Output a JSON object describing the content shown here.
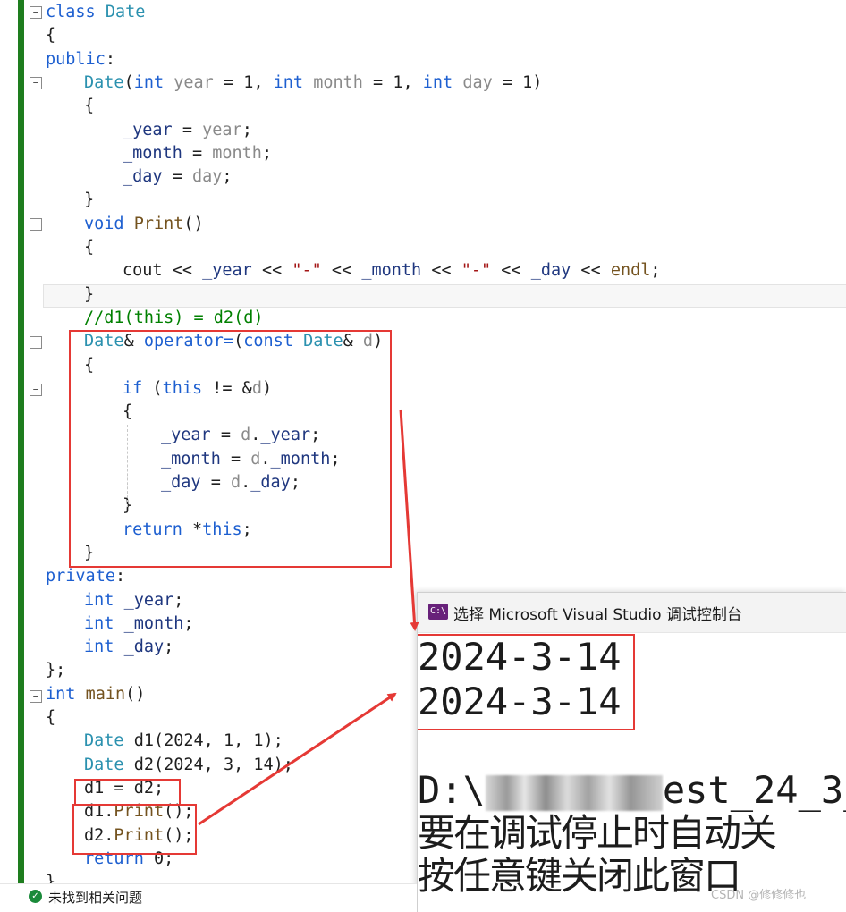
{
  "code": {
    "lines": [
      {
        "indent": 0,
        "tokens": [
          {
            "t": "class ",
            "c": "kw"
          },
          {
            "t": "Date",
            "c": "ty"
          }
        ]
      },
      {
        "indent": 0,
        "tokens": [
          {
            "t": "{",
            "c": ""
          }
        ]
      },
      {
        "indent": 0,
        "tokens": [
          {
            "t": "public",
            "c": "kw"
          },
          {
            "t": ":",
            "c": ""
          }
        ]
      },
      {
        "indent": 1,
        "tokens": [
          {
            "t": "Date",
            "c": "ty"
          },
          {
            "t": "(",
            "c": ""
          },
          {
            "t": "int",
            "c": "kw"
          },
          {
            "t": " ",
            "c": ""
          },
          {
            "t": "year",
            "c": "pa"
          },
          {
            "t": " = 1, ",
            "c": ""
          },
          {
            "t": "int",
            "c": "kw"
          },
          {
            "t": " ",
            "c": ""
          },
          {
            "t": "month",
            "c": "pa"
          },
          {
            "t": " = 1, ",
            "c": ""
          },
          {
            "t": "int",
            "c": "kw"
          },
          {
            "t": " ",
            "c": ""
          },
          {
            "t": "day",
            "c": "pa"
          },
          {
            "t": " = 1)",
            "c": ""
          }
        ]
      },
      {
        "indent": 1,
        "tokens": [
          {
            "t": "{",
            "c": ""
          }
        ]
      },
      {
        "indent": 2,
        "tokens": [
          {
            "t": "_year",
            "c": "mb"
          },
          {
            "t": " = ",
            "c": ""
          },
          {
            "t": "year",
            "c": "pa"
          },
          {
            "t": ";",
            "c": ""
          }
        ]
      },
      {
        "indent": 2,
        "tokens": [
          {
            "t": "_month",
            "c": "mb"
          },
          {
            "t": " = ",
            "c": ""
          },
          {
            "t": "month",
            "c": "pa"
          },
          {
            "t": ";",
            "c": ""
          }
        ]
      },
      {
        "indent": 2,
        "tokens": [
          {
            "t": "_day",
            "c": "mb"
          },
          {
            "t": " = ",
            "c": ""
          },
          {
            "t": "day",
            "c": "pa"
          },
          {
            "t": ";",
            "c": ""
          }
        ]
      },
      {
        "indent": 1,
        "tokens": [
          {
            "t": "}",
            "c": ""
          }
        ]
      },
      {
        "indent": 1,
        "tokens": [
          {
            "t": "void",
            "c": "kw"
          },
          {
            "t": " ",
            "c": ""
          },
          {
            "t": "Print",
            "c": "fn"
          },
          {
            "t": "()",
            "c": ""
          }
        ]
      },
      {
        "indent": 1,
        "tokens": [
          {
            "t": "{",
            "c": ""
          }
        ]
      },
      {
        "indent": 2,
        "tokens": [
          {
            "t": "cout << ",
            "c": ""
          },
          {
            "t": "_year",
            "c": "mb"
          },
          {
            "t": " << ",
            "c": ""
          },
          {
            "t": "\"-\"",
            "c": "st"
          },
          {
            "t": " << ",
            "c": ""
          },
          {
            "t": "_month",
            "c": "mb"
          },
          {
            "t": " << ",
            "c": ""
          },
          {
            "t": "\"-\"",
            "c": "st"
          },
          {
            "t": " << ",
            "c": ""
          },
          {
            "t": "_day",
            "c": "mb"
          },
          {
            "t": " << ",
            "c": ""
          },
          {
            "t": "endl",
            "c": "fn"
          },
          {
            "t": ";",
            "c": ""
          }
        ]
      },
      {
        "indent": 1,
        "tokens": [
          {
            "t": "}",
            "c": ""
          }
        ]
      },
      {
        "indent": 1,
        "tokens": [
          {
            "t": "//d1(this) = d2(d)",
            "c": "cm"
          }
        ]
      },
      {
        "indent": 1,
        "tokens": [
          {
            "t": "Date",
            "c": "ty"
          },
          {
            "t": "& ",
            "c": ""
          },
          {
            "t": "operator=",
            "c": "kw"
          },
          {
            "t": "(",
            "c": ""
          },
          {
            "t": "const",
            "c": "kw"
          },
          {
            "t": " ",
            "c": ""
          },
          {
            "t": "Date",
            "c": "ty"
          },
          {
            "t": "& ",
            "c": ""
          },
          {
            "t": "d",
            "c": "pa"
          },
          {
            "t": ")",
            "c": ""
          }
        ]
      },
      {
        "indent": 1,
        "tokens": [
          {
            "t": "{",
            "c": ""
          }
        ]
      },
      {
        "indent": 2,
        "tokens": [
          {
            "t": "if",
            "c": "kw"
          },
          {
            "t": " (",
            "c": ""
          },
          {
            "t": "this",
            "c": "kw"
          },
          {
            "t": " != &",
            "c": ""
          },
          {
            "t": "d",
            "c": "pa"
          },
          {
            "t": ")",
            "c": ""
          }
        ]
      },
      {
        "indent": 2,
        "tokens": [
          {
            "t": "{",
            "c": ""
          }
        ]
      },
      {
        "indent": 3,
        "tokens": [
          {
            "t": "_year",
            "c": "mb"
          },
          {
            "t": " = ",
            "c": ""
          },
          {
            "t": "d",
            "c": "pa"
          },
          {
            "t": ".",
            "c": ""
          },
          {
            "t": "_year",
            "c": "mb"
          },
          {
            "t": ";",
            "c": ""
          }
        ]
      },
      {
        "indent": 3,
        "tokens": [
          {
            "t": "_month",
            "c": "mb"
          },
          {
            "t": " = ",
            "c": ""
          },
          {
            "t": "d",
            "c": "pa"
          },
          {
            "t": ".",
            "c": ""
          },
          {
            "t": "_month",
            "c": "mb"
          },
          {
            "t": ";",
            "c": ""
          }
        ]
      },
      {
        "indent": 3,
        "tokens": [
          {
            "t": "_day",
            "c": "mb"
          },
          {
            "t": " = ",
            "c": ""
          },
          {
            "t": "d",
            "c": "pa"
          },
          {
            "t": ".",
            "c": ""
          },
          {
            "t": "_day",
            "c": "mb"
          },
          {
            "t": ";",
            "c": ""
          }
        ]
      },
      {
        "indent": 2,
        "tokens": [
          {
            "t": "}",
            "c": ""
          }
        ]
      },
      {
        "indent": 2,
        "tokens": [
          {
            "t": "return",
            "c": "kw"
          },
          {
            "t": " *",
            "c": ""
          },
          {
            "t": "this",
            "c": "kw"
          },
          {
            "t": ";",
            "c": ""
          }
        ]
      },
      {
        "indent": 1,
        "tokens": [
          {
            "t": "}",
            "c": ""
          }
        ]
      },
      {
        "indent": 0,
        "tokens": [
          {
            "t": "private",
            "c": "kw"
          },
          {
            "t": ":",
            "c": ""
          }
        ]
      },
      {
        "indent": 1,
        "tokens": [
          {
            "t": "int",
            "c": "kw"
          },
          {
            "t": " ",
            "c": ""
          },
          {
            "t": "_year",
            "c": "mb"
          },
          {
            "t": ";",
            "c": ""
          }
        ]
      },
      {
        "indent": 1,
        "tokens": [
          {
            "t": "int",
            "c": "kw"
          },
          {
            "t": " ",
            "c": ""
          },
          {
            "t": "_month",
            "c": "mb"
          },
          {
            "t": ";",
            "c": ""
          }
        ]
      },
      {
        "indent": 1,
        "tokens": [
          {
            "t": "int",
            "c": "kw"
          },
          {
            "t": " ",
            "c": ""
          },
          {
            "t": "_day",
            "c": "mb"
          },
          {
            "t": ";",
            "c": ""
          }
        ]
      },
      {
        "indent": 0,
        "tokens": [
          {
            "t": "};",
            "c": ""
          }
        ]
      },
      {
        "indent": 0,
        "tokens": [
          {
            "t": "int",
            "c": "kw"
          },
          {
            "t": " ",
            "c": ""
          },
          {
            "t": "main",
            "c": "fn"
          },
          {
            "t": "()",
            "c": ""
          }
        ]
      },
      {
        "indent": 0,
        "tokens": [
          {
            "t": "{",
            "c": ""
          }
        ]
      },
      {
        "indent": 1,
        "tokens": [
          {
            "t": "Date",
            "c": "ty"
          },
          {
            "t": " d1(2024, 1, 1);",
            "c": ""
          }
        ]
      },
      {
        "indent": 1,
        "tokens": [
          {
            "t": "Date",
            "c": "ty"
          },
          {
            "t": " d2(2024, 3, 14);",
            "c": ""
          }
        ]
      },
      {
        "indent": 1,
        "tokens": [
          {
            "t": "d1 = d2;",
            "c": ""
          }
        ]
      },
      {
        "indent": 1,
        "tokens": [
          {
            "t": "d1.",
            "c": ""
          },
          {
            "t": "Print",
            "c": "fn"
          },
          {
            "t": "();",
            "c": ""
          }
        ]
      },
      {
        "indent": 1,
        "tokens": [
          {
            "t": "d2.",
            "c": ""
          },
          {
            "t": "Print",
            "c": "fn"
          },
          {
            "t": "();",
            "c": ""
          }
        ]
      },
      {
        "indent": 1,
        "tokens": [
          {
            "t": "return",
            "c": "kw"
          },
          {
            "t": " 0;",
            "c": ""
          }
        ]
      },
      {
        "indent": 0,
        "tokens": [
          {
            "t": "}",
            "c": ""
          }
        ]
      }
    ]
  },
  "colors": {
    "keyword": "#1d5fd0",
    "type": "#2b91af",
    "function": "#74531f",
    "parameter": "#8a8a8a",
    "string": "#a31515",
    "comment": "#008000",
    "member": "#1f377f",
    "annotation_red": "#e53935",
    "change_bar": "#1e7d1e"
  },
  "console": {
    "title": "选择 Microsoft Visual Studio 调试控制台",
    "icon": "vs-debug-console-icon",
    "output": [
      "2024-3-14",
      "2024-3-14"
    ],
    "path_prefix": "D:\\",
    "path_suffix": "est_24_3_",
    "message_1": "要在调试停止时自动关",
    "message_2": "按任意键关闭此窗口"
  },
  "status": {
    "icon": "check-circle-icon",
    "text": "未找到相关问题"
  },
  "watermark": "CSDN @修修修也"
}
